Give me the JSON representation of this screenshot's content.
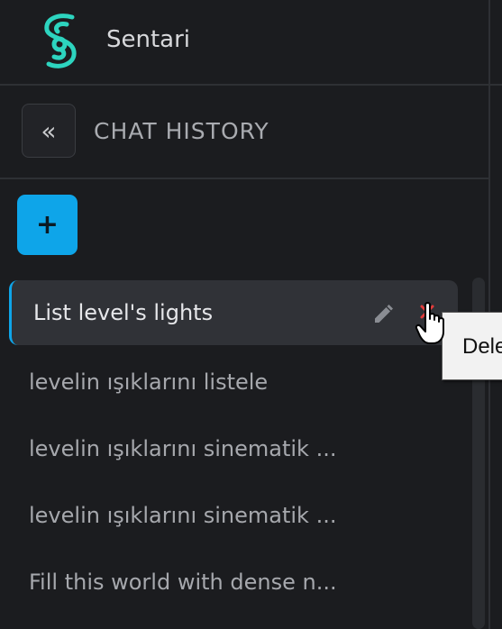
{
  "app": {
    "name": "Sentari",
    "accent_color": "#0ea5e9",
    "logo_color": "#2dd4bf"
  },
  "history": {
    "collapse_label": "«",
    "title": "CHAT HISTORY"
  },
  "new_chat": {
    "label": "+"
  },
  "chats": [
    {
      "title": "List level's lights",
      "active": true
    },
    {
      "title": "levelin ışıklarını listele",
      "active": false
    },
    {
      "title": "levelin ışıklarını sinematik ...",
      "active": false
    },
    {
      "title": "levelin ışıklarını sinematik ...",
      "active": false
    },
    {
      "title": "Fill this world with dense n...",
      "active": false
    }
  ],
  "icons": {
    "edit": "pencil-icon",
    "delete": "close-icon",
    "cursor": "hand-pointer-icon"
  },
  "tooltip": {
    "text": "Dele"
  }
}
